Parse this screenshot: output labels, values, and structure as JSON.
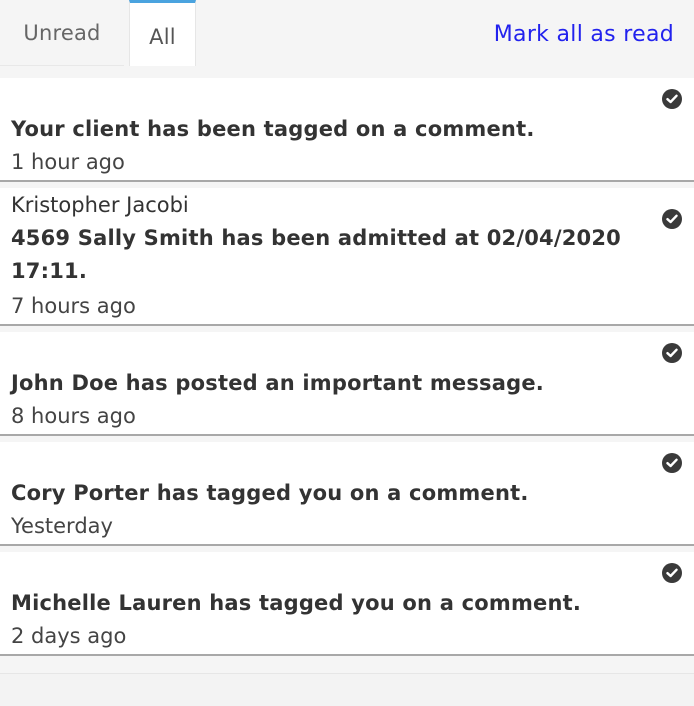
{
  "tabs": {
    "unread_label": "Unread",
    "all_label": "All",
    "active": "All"
  },
  "actions": {
    "mark_all_read": "Mark all as read"
  },
  "notifications": [
    {
      "sender": "",
      "message": "Your client has been tagged on a comment.",
      "time": "1 hour ago",
      "icon": "check-circle-icon"
    },
    {
      "sender": "Kristopher Jacobi",
      "message_line1": "4569 Sally Smith has been admitted at 02/04/2020",
      "message_line2": "17:11.",
      "time": "7 hours ago",
      "icon": "check-circle-icon"
    },
    {
      "sender": "",
      "message": "John Doe has posted an important message.",
      "time": "8 hours ago",
      "icon": "check-circle-icon"
    },
    {
      "sender": "",
      "message": "Cory Porter has tagged you on a comment.",
      "time": "Yesterday",
      "icon": "check-circle-icon"
    },
    {
      "sender": "",
      "message": "Michelle Lauren has tagged you on a comment.",
      "time": "2 days ago",
      "icon": "check-circle-icon"
    }
  ],
  "colors": {
    "link": "#2222ee",
    "active_tab_accent": "#4aa3df",
    "divider": "#a8a8a8",
    "background": "#f5f5f5"
  }
}
